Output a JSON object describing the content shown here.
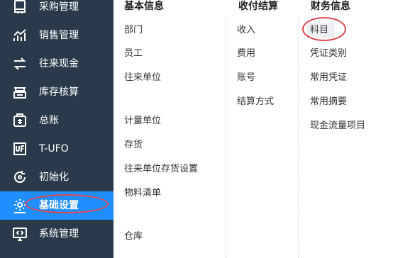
{
  "sidebar": {
    "items": [
      {
        "label": "采购管理",
        "icon": "purchase-icon"
      },
      {
        "label": "销售管理",
        "icon": "sales-chart-icon"
      },
      {
        "label": "往来现金",
        "icon": "exchange-icon"
      },
      {
        "label": "库存核算",
        "icon": "inventory-icon"
      },
      {
        "label": "总账",
        "icon": "ledger-icon"
      },
      {
        "label": "T-UFO",
        "icon": "ufo-icon"
      },
      {
        "label": "初始化",
        "icon": "init-icon"
      },
      {
        "label": "基础设置",
        "icon": "settings-gear-icon",
        "active": true
      },
      {
        "label": "系统管理",
        "icon": "system-icon"
      }
    ],
    "colors": {
      "background": "#2b3a4a",
      "active": "#1f8fff",
      "highlight_ring": "#e0464b"
    }
  },
  "menu": {
    "columns": [
      {
        "title": "基本信息",
        "items": [
          "部门",
          "员工",
          "往来单位",
          "计量单位",
          "存货",
          "往来单位存货设置",
          "物料清单",
          "仓库"
        ]
      },
      {
        "title": "收付结算",
        "items": [
          "收入",
          "费用",
          "账号",
          "结算方式"
        ]
      },
      {
        "title": "财务信息",
        "items": [
          "科目",
          "凭证类别",
          "常用凭证",
          "常用摘要",
          "现金流量项目"
        ],
        "selected": "科目"
      }
    ]
  }
}
